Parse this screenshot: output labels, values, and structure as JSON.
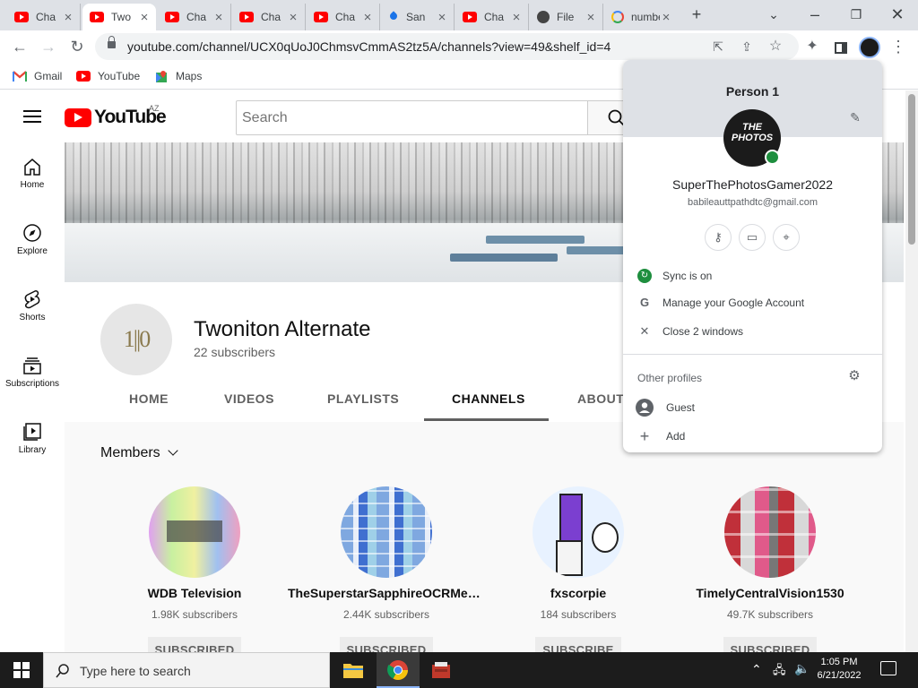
{
  "browser": {
    "tabs": [
      {
        "title": "Cha",
        "favicon": "youtube-icon"
      },
      {
        "title": "Two",
        "favicon": "youtube-icon",
        "active": true
      },
      {
        "title": "Cha",
        "favicon": "youtube-icon"
      },
      {
        "title": "Cha",
        "favicon": "youtube-icon"
      },
      {
        "title": "Cha",
        "favicon": "youtube-icon"
      },
      {
        "title": "San",
        "favicon": "droplet-icon"
      },
      {
        "title": "Cha",
        "favicon": "youtube-icon"
      },
      {
        "title": "File",
        "favicon": "github-icon"
      },
      {
        "title": "number",
        "favicon": "google-icon"
      }
    ],
    "url": "youtube.com/channel/UCX0qUoJ0ChmsvCmmAS2tz5A/channels?view=49&shelf_id=4",
    "bookmarks": [
      {
        "label": "Gmail",
        "icon": "gmail-icon"
      },
      {
        "label": "YouTube",
        "icon": "youtube-icon"
      },
      {
        "label": "Maps",
        "icon": "maps-icon"
      }
    ]
  },
  "youtube": {
    "logo_text": "YouTube",
    "country_code": "AZ",
    "search_placeholder": "Search",
    "sidebar": [
      {
        "label": "Home",
        "icon": "home-icon"
      },
      {
        "label": "Explore",
        "icon": "compass-icon"
      },
      {
        "label": "Shorts",
        "icon": "shorts-icon"
      },
      {
        "label": "Subscriptions",
        "icon": "subscriptions-icon"
      },
      {
        "label": "Library",
        "icon": "library-icon"
      }
    ],
    "channel": {
      "avatar_text": "1||0",
      "name": "Twoniton Alternate",
      "subscribers": "22 subscribers",
      "tabs": [
        "HOME",
        "VIDEOS",
        "PLAYLISTS",
        "CHANNELS",
        "ABOUT"
      ],
      "active_tab": "CHANNELS"
    },
    "section_title": "Members",
    "members": [
      {
        "name": "WDB Television",
        "subscribers": "1.98K subscribers",
        "button": "SUBSCRIBED"
      },
      {
        "name": "TheSuperstarSapphireOCRMedi…",
        "subscribers": "2.44K subscribers",
        "button": "SUBSCRIBED"
      },
      {
        "name": "fxscorpie",
        "subscribers": "184 subscribers",
        "button": "SUBSCRIBE"
      },
      {
        "name": "TimelyCentralVision1530",
        "subscribers": "49.7K subscribers",
        "button": "SUBSCRIBED"
      }
    ]
  },
  "profile_menu": {
    "person": "Person 1",
    "avatar_text": "THE PHOTOS",
    "username": "SuperThePhotosGamer2022",
    "email": "babileauttpathdtc@gmail.com",
    "items": [
      {
        "label": "Sync is on",
        "icon": "sync-icon"
      },
      {
        "label": "Manage your Google Account",
        "icon": "google-icon"
      },
      {
        "label": "Close 2 windows",
        "icon": "close-icon"
      }
    ],
    "other_profiles_label": "Other profiles",
    "other_profiles": [
      {
        "label": "Guest",
        "icon": "guest-icon"
      },
      {
        "label": "Add",
        "icon": "plus-icon"
      }
    ]
  },
  "taskbar": {
    "search_placeholder": "Type here to search",
    "time": "1:05 PM",
    "date": "6/21/2022"
  }
}
